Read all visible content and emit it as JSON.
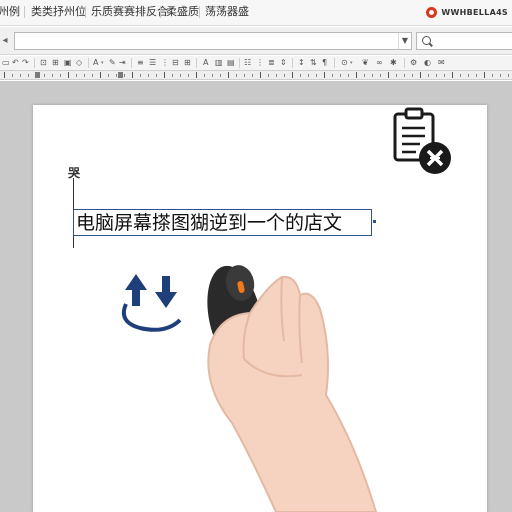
{
  "menu": {
    "items": [
      "州例",
      "类类抒州位",
      "乐质赛赛排反合",
      "柔盛质",
      "荡荡器盛"
    ]
  },
  "brand": {
    "text": "WWHBELLA4S"
  },
  "toolbar": {
    "address_value": "",
    "search_value": ""
  },
  "icons": {
    "search": "search-icon",
    "clipboard": "clipboard-cross-icon",
    "sync": "sync-arrows-icon",
    "hand": "hand-on-mouse-illustration"
  },
  "document": {
    "margin_mark": "哭",
    "textbox_text": "电脑屏幕搽图猢逆到一个的店文"
  },
  "colors": {
    "accent_blue": "#2b4f8f",
    "brand_red": "#d9381e",
    "mouse_orange": "#f07a1a"
  }
}
